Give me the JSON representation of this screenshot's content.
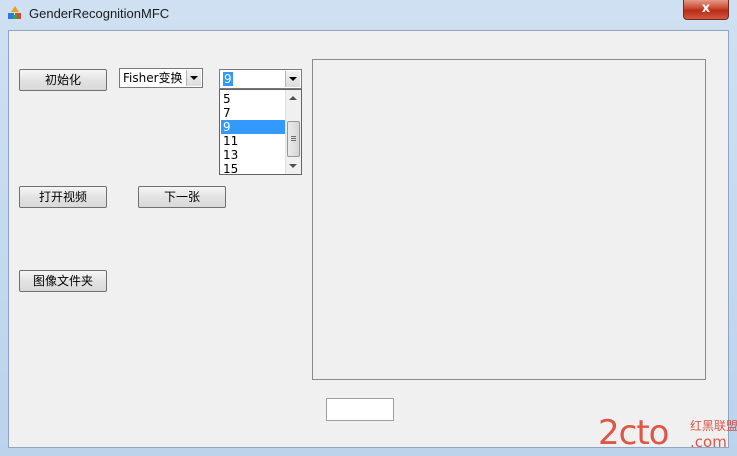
{
  "window": {
    "title": "GenderRecognitionMFC",
    "close_label": "x"
  },
  "buttons": {
    "init": "初始化",
    "open_video": "打开视频",
    "next": "下一张",
    "image_folder": "图像文件夹"
  },
  "method_combo": {
    "value": "Fisher变换"
  },
  "size_combo": {
    "value": "9",
    "options": [
      "5",
      "7",
      "9",
      "11",
      "13",
      "15"
    ],
    "selected_index": 2
  },
  "watermark": {
    "logo_text": "2cto",
    "suffix": ".com",
    "cn_text": "红黑联盟"
  },
  "colors": {
    "selection": "#3399ff",
    "watermark": "#d9301c"
  }
}
